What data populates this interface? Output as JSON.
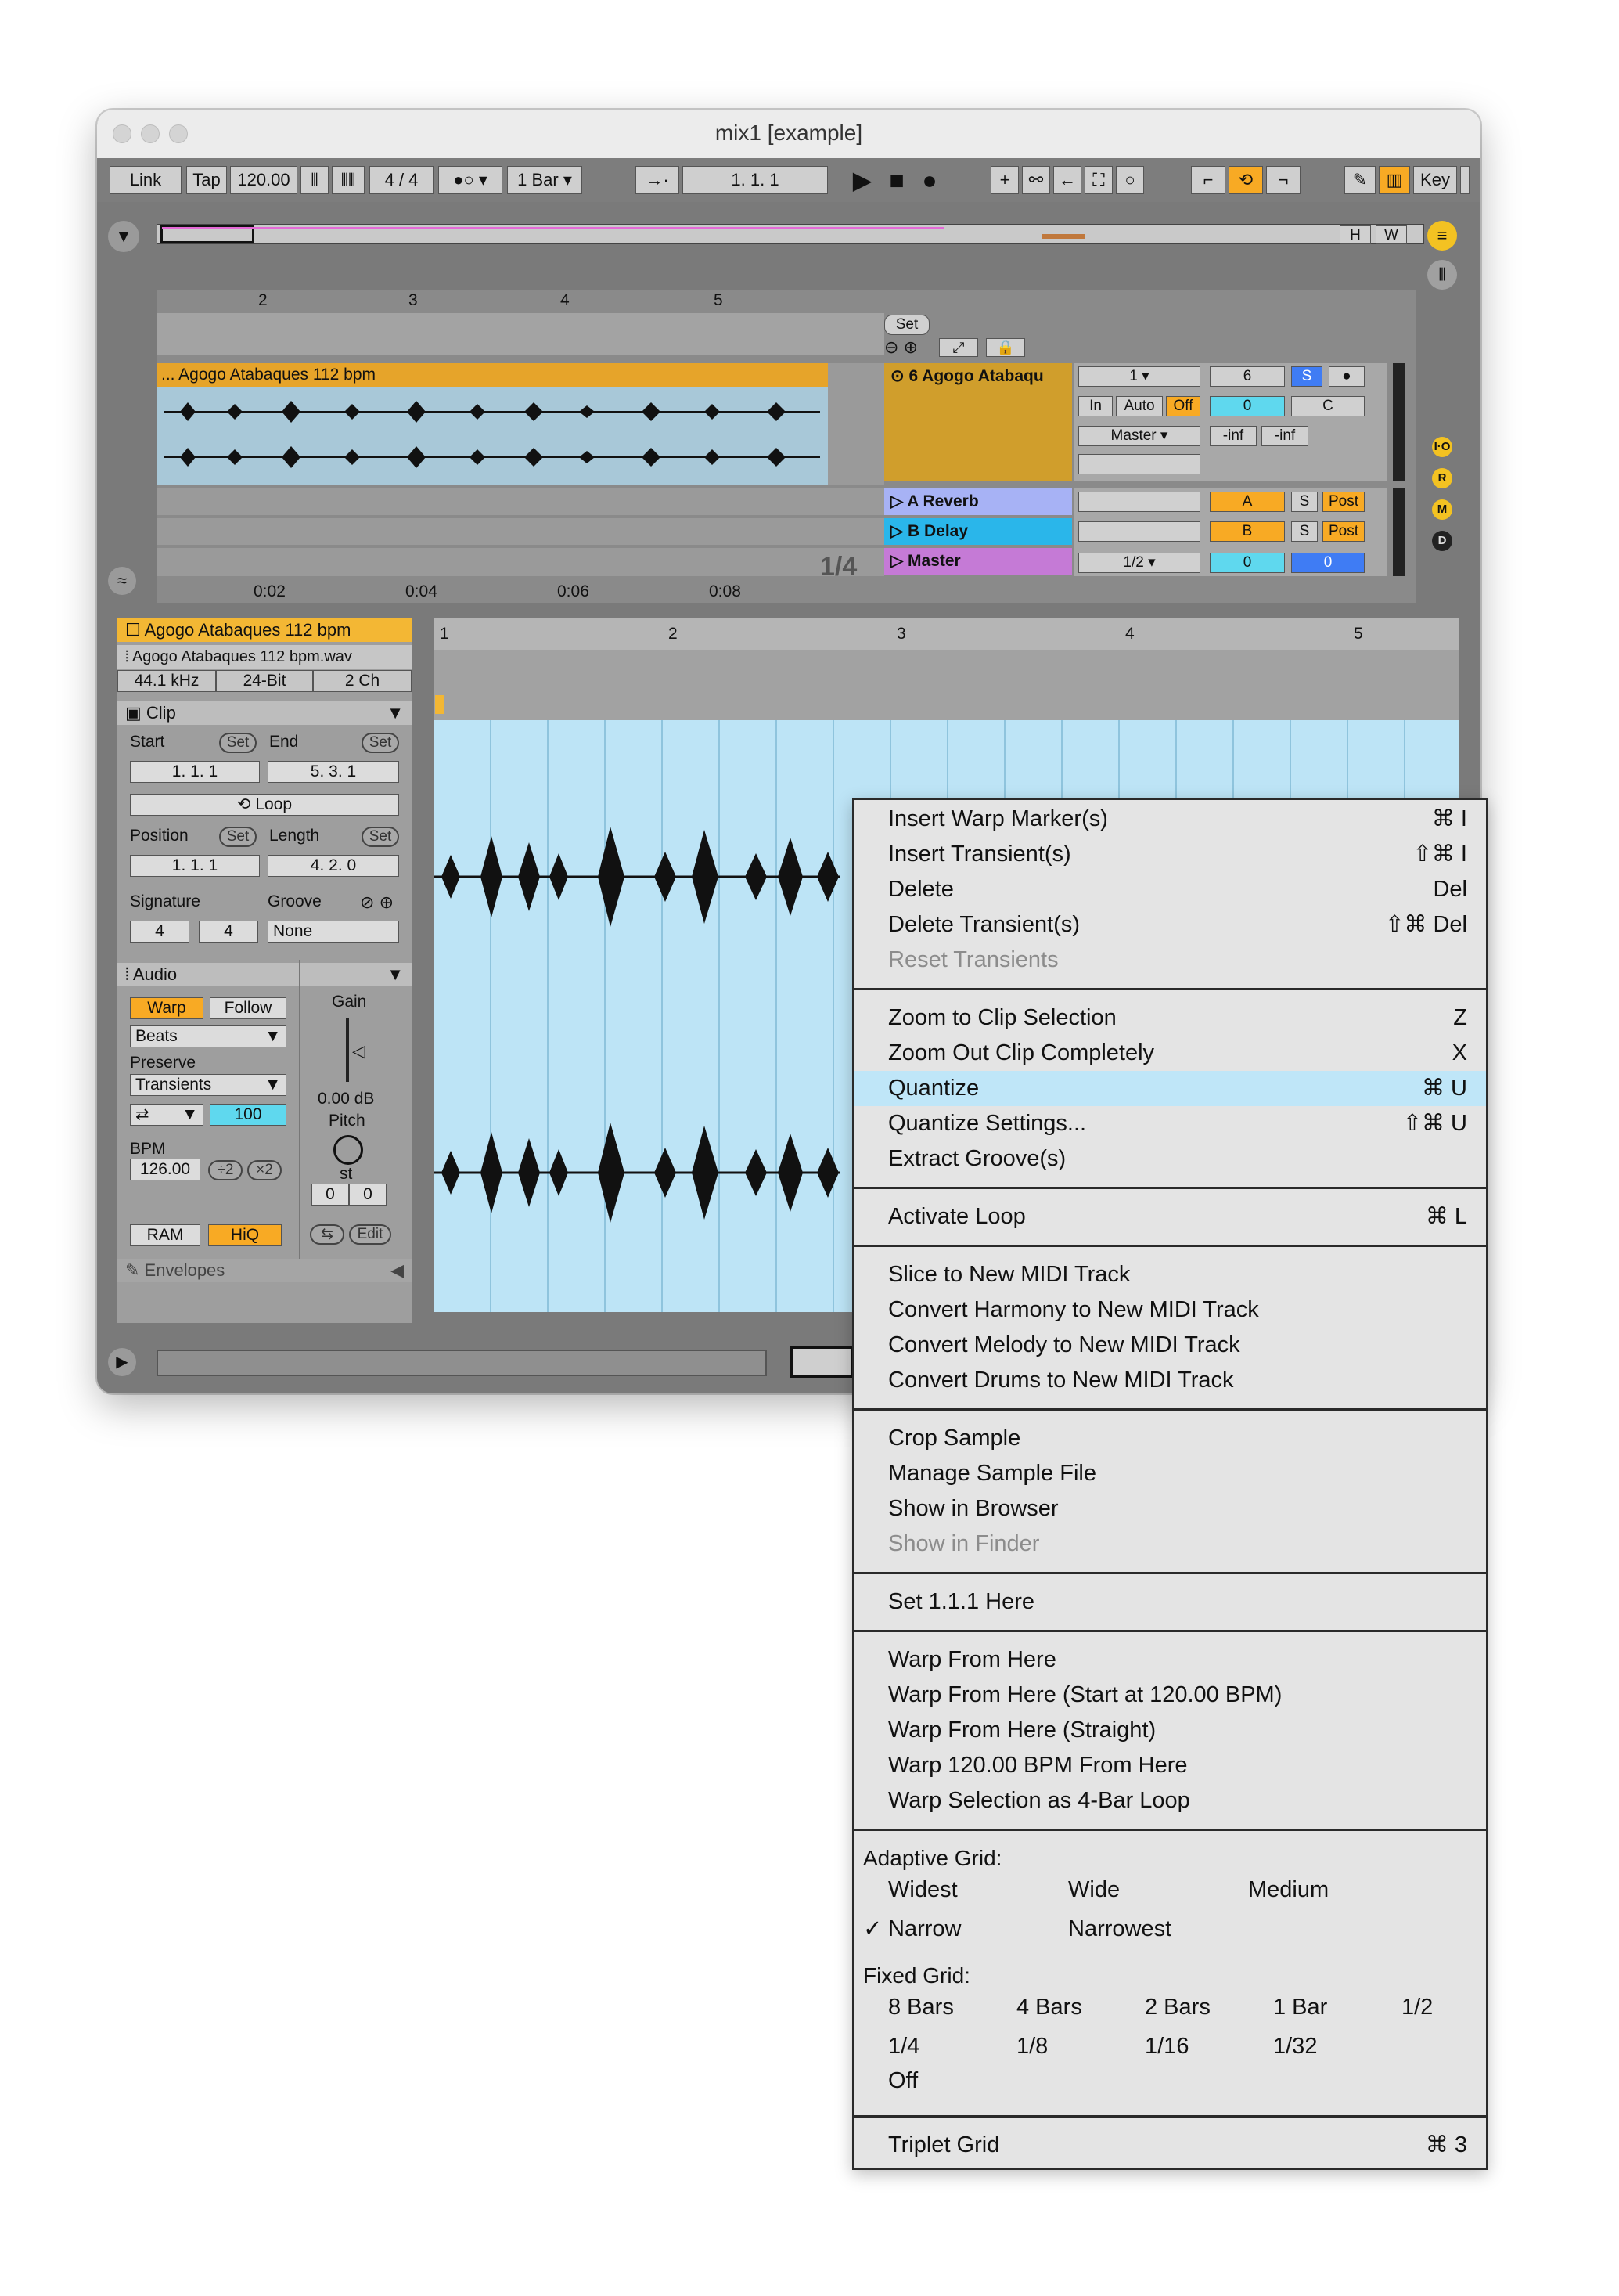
{
  "window": {
    "title": "mix1  [example]"
  },
  "control_bar": {
    "link": "Link",
    "tap": "Tap",
    "tempo": "120.00",
    "signature": "4 / 4",
    "quantization": "1 Bar",
    "position": "1.   1.   1",
    "key": "Key"
  },
  "overview": {
    "h_button": "H",
    "w_button": "W"
  },
  "arrangement": {
    "bar_numbers": [
      "2",
      "3",
      "4",
      "5"
    ],
    "time_labels": [
      "0:02",
      "0:04",
      "0:06",
      "0:08"
    ],
    "set_button": "Set",
    "page_indicator": "1/4",
    "clip_name": "... Agogo Atabaques 112 bpm",
    "tracks": [
      {
        "name": "6 Agogo Atabaqu",
        "color": "#d09e2c"
      },
      {
        "name": "A Reverb",
        "color": "#a7b2f5"
      },
      {
        "name": "B Delay",
        "color": "#2ab6ea"
      },
      {
        "name": "Master",
        "color": "#c57ad6"
      }
    ],
    "mixer": {
      "input_channel": "1",
      "monitor": [
        "In",
        "Auto",
        "Off"
      ],
      "output": "Master",
      "track_number": "6",
      "solo": "S",
      "pan": "C",
      "volume": "0",
      "peak_left": "-inf",
      "peak_right": "-inf",
      "reverb_send": "A",
      "delay_send": "B",
      "post": "Post",
      "master_cue": "1/2",
      "master_volume": "0",
      "master_pan": "0"
    }
  },
  "clip_view": {
    "clip_name": "Agogo Atabaques 112 bpm",
    "file_name": "Agogo Atabaques 112 bpm.wav",
    "sample_rate": "44.1 kHz",
    "bit_depth": "24-Bit",
    "channels": "2 Ch",
    "clip_section": "Clip",
    "start_label": "Start",
    "end_label": "End",
    "set_label": "Set",
    "start_value": "1.    1.    1",
    "end_value": "5.    3.    1",
    "loop_label": "Loop",
    "position_label": "Position",
    "length_label": "Length",
    "position_value": "1.    1.    1",
    "length_value": "4.    2.    0",
    "signature_label": "Signature",
    "groove_label": "Groove",
    "sig_num": "4",
    "sig_den": "4",
    "groove_value": "None",
    "audio_section": "Audio",
    "warp": "Warp",
    "follow": "Follow",
    "warp_mode": "Beats",
    "preserve_label": "Preserve",
    "preserve_value": "Transients",
    "transient_amount": "100",
    "gain_label": "Gain",
    "gain_value": "0.00 dB",
    "pitch_label": "Pitch",
    "pitch_unit": "st",
    "pitch_semitones": "0",
    "pitch_cents": "0",
    "bpm_label": "BPM",
    "bpm_value": "126.00",
    "halve": "÷2",
    "double": "×2",
    "ram": "RAM",
    "hiq": "HiQ",
    "edit": "Edit",
    "envelopes": "Envelopes"
  },
  "editor": {
    "bar_numbers": [
      "1",
      "2",
      "3",
      "4",
      "5"
    ]
  },
  "context_menu": {
    "group1": [
      {
        "label": "Insert Warp Marker(s)",
        "shortcut": "⌘ I"
      },
      {
        "label": "Insert Transient(s)",
        "shortcut": "⇧⌘ I"
      },
      {
        "label": "Delete",
        "shortcut": "Del"
      },
      {
        "label": "Delete Transient(s)",
        "shortcut": "⇧⌘ Del"
      },
      {
        "label": "Reset Transients",
        "shortcut": ""
      }
    ],
    "group2": [
      {
        "label": "Zoom to Clip Selection",
        "shortcut": "Z"
      },
      {
        "label": "Zoom Out Clip Completely",
        "shortcut": "X"
      },
      {
        "label": "Quantize",
        "shortcut": "⌘ U"
      },
      {
        "label": "Quantize Settings...",
        "shortcut": "⇧⌘ U"
      },
      {
        "label": "Extract Groove(s)",
        "shortcut": ""
      }
    ],
    "group3": [
      {
        "label": "Activate Loop",
        "shortcut": "⌘ L"
      }
    ],
    "group4": [
      {
        "label": "Slice to New MIDI Track"
      },
      {
        "label": "Convert Harmony to New MIDI Track"
      },
      {
        "label": "Convert Melody to New MIDI Track"
      },
      {
        "label": "Convert Drums to New MIDI Track"
      }
    ],
    "group5": [
      {
        "label": "Crop Sample"
      },
      {
        "label": "Manage Sample File"
      },
      {
        "label": "Show in Browser"
      },
      {
        "label": "Show in Finder"
      }
    ],
    "group6": [
      {
        "label": "Set 1.1.1 Here"
      }
    ],
    "group7": [
      {
        "label": "Warp From Here"
      },
      {
        "label": "Warp From Here (Start at 120.00 BPM)"
      },
      {
        "label": "Warp From Here (Straight)"
      },
      {
        "label": "Warp 120.00 BPM From Here"
      },
      {
        "label": "Warp Selection as 4-Bar Loop"
      }
    ],
    "adaptive_grid": {
      "heading": "Adaptive Grid:",
      "options": [
        "Widest",
        "Wide",
        "Medium",
        "Narrow",
        "Narrowest"
      ],
      "checkmark": "✓"
    },
    "fixed_grid": {
      "heading": "Fixed Grid:",
      "options": [
        "8 Bars",
        "4 Bars",
        "2 Bars",
        "1 Bar",
        "1/2",
        "1/4",
        "1/8",
        "1/16",
        "1/32",
        "Off"
      ]
    },
    "triplet": {
      "label": "Triplet Grid",
      "shortcut": "⌘ 3"
    }
  }
}
